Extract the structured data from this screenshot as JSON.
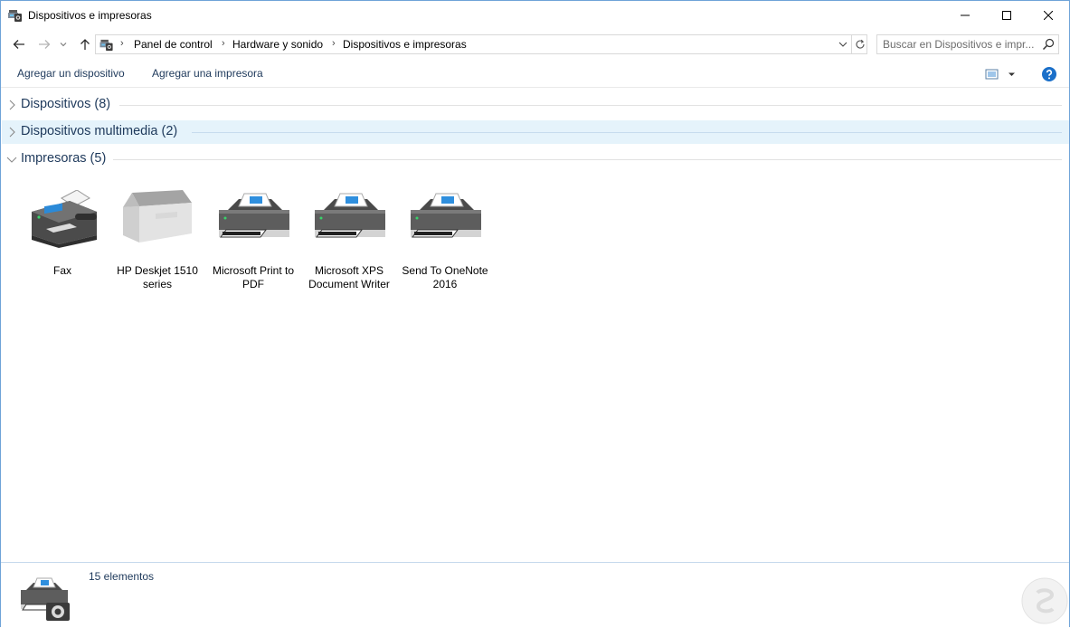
{
  "window": {
    "title": "Dispositivos e impresoras"
  },
  "address": {
    "breadcrumbs": [
      "Panel de control",
      "Hardware y sonido",
      "Dispositivos e impresoras"
    ]
  },
  "search": {
    "placeholder": "Buscar en Dispositivos e impr..."
  },
  "toolbar": {
    "add_device": "Agregar un dispositivo",
    "add_printer": "Agregar una impresora"
  },
  "groups": [
    {
      "label": "Dispositivos (8)",
      "expanded": false
    },
    {
      "label": "Dispositivos multimedia (2)",
      "expanded": false
    },
    {
      "label": "Impresoras (5)",
      "expanded": true
    }
  ],
  "printers": [
    {
      "label": "Fax",
      "icon": "fax-icon"
    },
    {
      "label": "HP Deskjet 1510 series",
      "icon": "hp-printer-icon"
    },
    {
      "label": "Microsoft Print to PDF",
      "icon": "printer-icon"
    },
    {
      "label": "Microsoft XPS Document Writer",
      "icon": "printer-icon"
    },
    {
      "label": "Send To OneNote 2016",
      "icon": "printer-icon"
    }
  ],
  "details": {
    "count_text": "15 elementos"
  },
  "colors": {
    "link_text": "#1e395b",
    "selected_group_bg": "#e5f3fb",
    "help_blue": "#1a6fc9",
    "window_border": "#6fa3d8"
  }
}
